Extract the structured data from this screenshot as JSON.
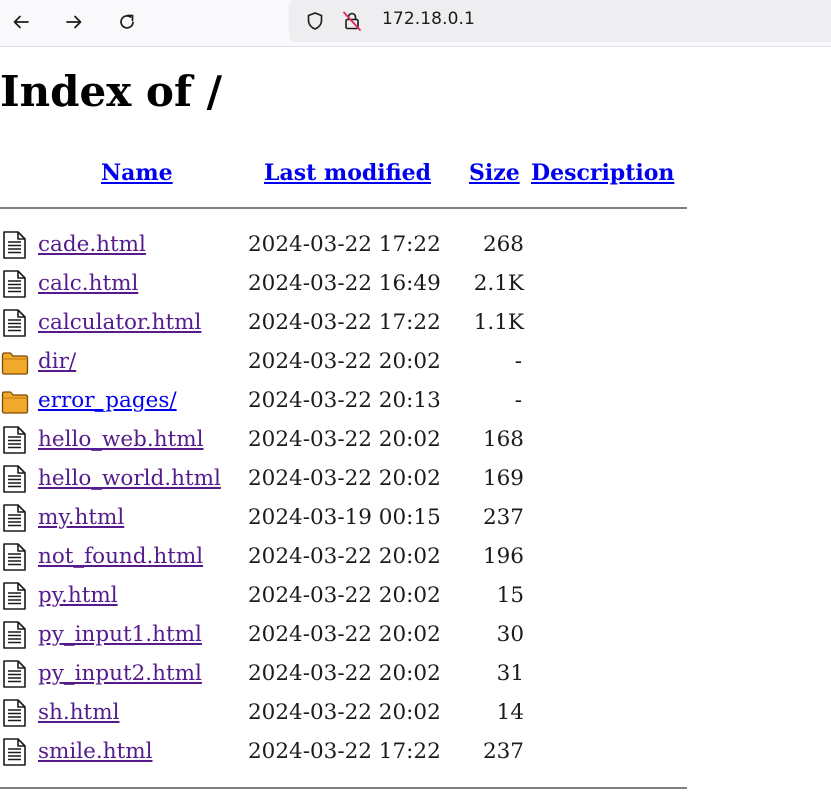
{
  "browser": {
    "back_icon": "arrow-left-icon",
    "forward_icon": "arrow-right-icon",
    "reload_icon": "reload-icon",
    "shield_icon": "shield-icon",
    "insecure_icon": "crossed-lock-icon",
    "url": "172.18.0.1"
  },
  "page": {
    "title": "Index of /",
    "columns": {
      "name": "Name",
      "last_modified": "Last modified",
      "size": "Size",
      "description": "Description"
    },
    "files": [
      {
        "name": "cade.html",
        "modified": "2024-03-22 17:22",
        "size": "268",
        "type": "file",
        "visited": true
      },
      {
        "name": "calc.html",
        "modified": "2024-03-22 16:49",
        "size": "2.1K",
        "type": "file",
        "visited": true
      },
      {
        "name": "calculator.html",
        "modified": "2024-03-22 17:22",
        "size": "1.1K",
        "type": "file",
        "visited": true
      },
      {
        "name": "dir/",
        "modified": "2024-03-22 20:02",
        "size": "-",
        "type": "folder",
        "visited": true
      },
      {
        "name": "error_pages/",
        "modified": "2024-03-22 20:13",
        "size": "-",
        "type": "folder",
        "visited": false
      },
      {
        "name": "hello_web.html",
        "modified": "2024-03-22 20:02",
        "size": "168",
        "type": "file",
        "visited": true
      },
      {
        "name": "hello_world.html",
        "modified": "2024-03-22 20:02",
        "size": "169",
        "type": "file",
        "visited": true
      },
      {
        "name": "my.html",
        "modified": "2024-03-19 00:15",
        "size": "237",
        "type": "file",
        "visited": true
      },
      {
        "name": "not_found.html",
        "modified": "2024-03-22 20:02",
        "size": "196",
        "type": "file",
        "visited": true
      },
      {
        "name": "py.html",
        "modified": "2024-03-22 20:02",
        "size": "15",
        "type": "file",
        "visited": true
      },
      {
        "name": "py_input1.html",
        "modified": "2024-03-22 20:02",
        "size": "30",
        "type": "file",
        "visited": true
      },
      {
        "name": "py_input2.html",
        "modified": "2024-03-22 20:02",
        "size": "31",
        "type": "file",
        "visited": true
      },
      {
        "name": "sh.html",
        "modified": "2024-03-22 20:02",
        "size": "14",
        "type": "file",
        "visited": true
      },
      {
        "name": "smile.html",
        "modified": "2024-03-22 17:22",
        "size": "237",
        "type": "file",
        "visited": true
      }
    ]
  },
  "colors": {
    "link": "#0000ee",
    "visited_link": "#551a8b",
    "folder": "#f0a92a",
    "rule": "#808080"
  }
}
